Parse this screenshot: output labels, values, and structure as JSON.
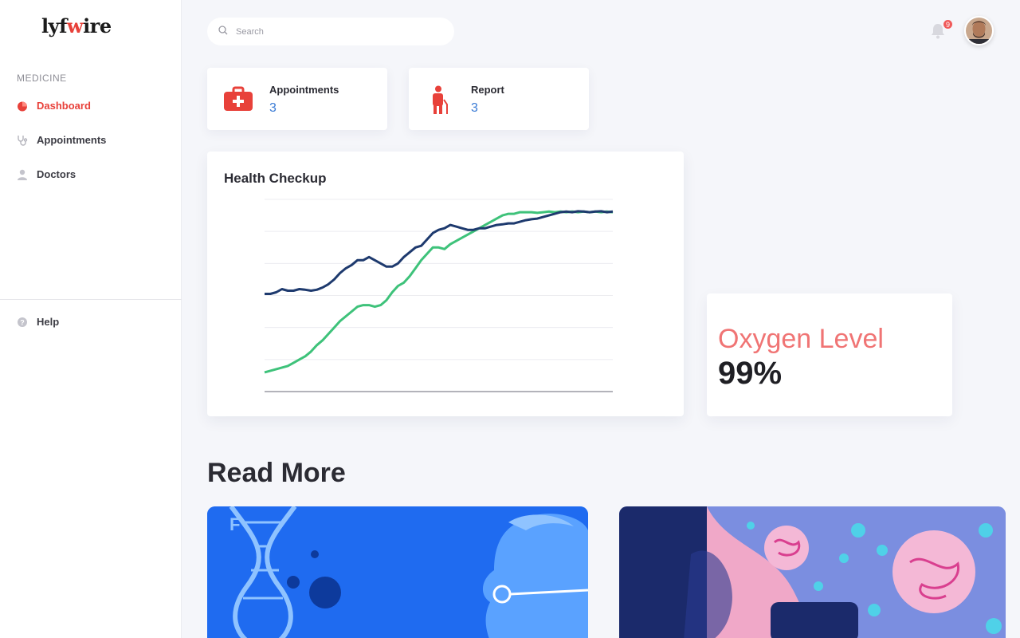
{
  "app": {
    "logo": {
      "pre": "lyf",
      "pulse": "w",
      "post": "ire"
    }
  },
  "sidebar": {
    "section_label": "MEDICINE",
    "items": [
      {
        "label": "Dashboard",
        "icon": "dashboard-icon",
        "active": true
      },
      {
        "label": "Appointments",
        "icon": "stethoscope-icon",
        "active": false
      },
      {
        "label": "Doctors",
        "icon": "doctor-icon",
        "active": false
      }
    ],
    "help_label": "Help"
  },
  "header": {
    "search_placeholder": "Search",
    "notification_count": "9"
  },
  "stats": [
    {
      "title": "Appointments",
      "value": "3",
      "icon": "medical-kit-icon"
    },
    {
      "title": "Report",
      "value": "3",
      "icon": "patient-icon"
    }
  ],
  "health": {
    "title": "Health Checkup"
  },
  "oxygen": {
    "label": "Oxygen Level",
    "value": "99%"
  },
  "read_more": {
    "title": "Read More"
  },
  "colors": {
    "accent": "#e8413a",
    "series_dark": "#1e3a6e",
    "series_green": "#3ec27a",
    "oxygen_label": "#f07474",
    "stat_value": "#3a7bd5"
  },
  "chart_data": {
    "type": "line",
    "title": "Health Checkup",
    "xlabel": "",
    "ylabel": "",
    "ylim": [
      0,
      6
    ],
    "grid": true,
    "x": [
      0,
      1,
      2,
      3,
      4,
      5,
      6,
      7,
      8,
      9,
      10,
      11,
      12,
      13,
      14,
      15,
      16,
      17,
      18,
      19,
      20,
      21,
      22,
      23,
      24,
      25,
      26,
      27,
      28,
      29,
      30,
      31,
      32,
      33,
      34,
      35,
      36,
      37,
      38,
      39,
      40,
      41,
      42,
      43,
      44,
      45,
      46,
      47,
      48,
      49,
      50,
      51,
      52,
      53,
      54,
      55,
      56,
      57,
      58,
      59,
      60
    ],
    "series": [
      {
        "values": [
          3.05,
          3.05,
          3.1,
          3.2,
          3.15,
          3.15,
          3.2,
          3.18,
          3.15,
          3.18,
          3.25,
          3.35,
          3.5,
          3.7,
          3.85,
          3.95,
          4.1,
          4.1,
          4.2,
          4.1,
          4.0,
          3.9,
          3.9,
          4.0,
          4.2,
          4.35,
          4.5,
          4.55,
          4.75,
          4.95,
          5.05,
          5.1,
          5.2,
          5.15,
          5.1,
          5.05,
          5.05,
          5.1,
          5.1,
          5.15,
          5.2,
          5.22,
          5.25,
          5.25,
          5.3,
          5.35,
          5.38,
          5.4,
          5.45,
          5.5,
          5.55,
          5.6,
          5.62,
          5.6,
          5.63,
          5.62,
          5.6,
          5.62,
          5.63,
          5.6,
          5.62
        ]
      },
      {
        "values": [
          0.6,
          0.65,
          0.7,
          0.75,
          0.8,
          0.9,
          1.0,
          1.1,
          1.25,
          1.45,
          1.6,
          1.8,
          2.0,
          2.2,
          2.35,
          2.5,
          2.65,
          2.7,
          2.7,
          2.65,
          2.7,
          2.85,
          3.1,
          3.3,
          3.4,
          3.6,
          3.85,
          4.1,
          4.3,
          4.5,
          4.5,
          4.45,
          4.6,
          4.7,
          4.8,
          4.9,
          5.0,
          5.1,
          5.2,
          5.3,
          5.4,
          5.5,
          5.55,
          5.55,
          5.6,
          5.6,
          5.6,
          5.58,
          5.6,
          5.62,
          5.6,
          5.62,
          5.6,
          5.62,
          5.6,
          5.62,
          5.6,
          5.62,
          5.6,
          5.62,
          5.6
        ]
      }
    ]
  }
}
